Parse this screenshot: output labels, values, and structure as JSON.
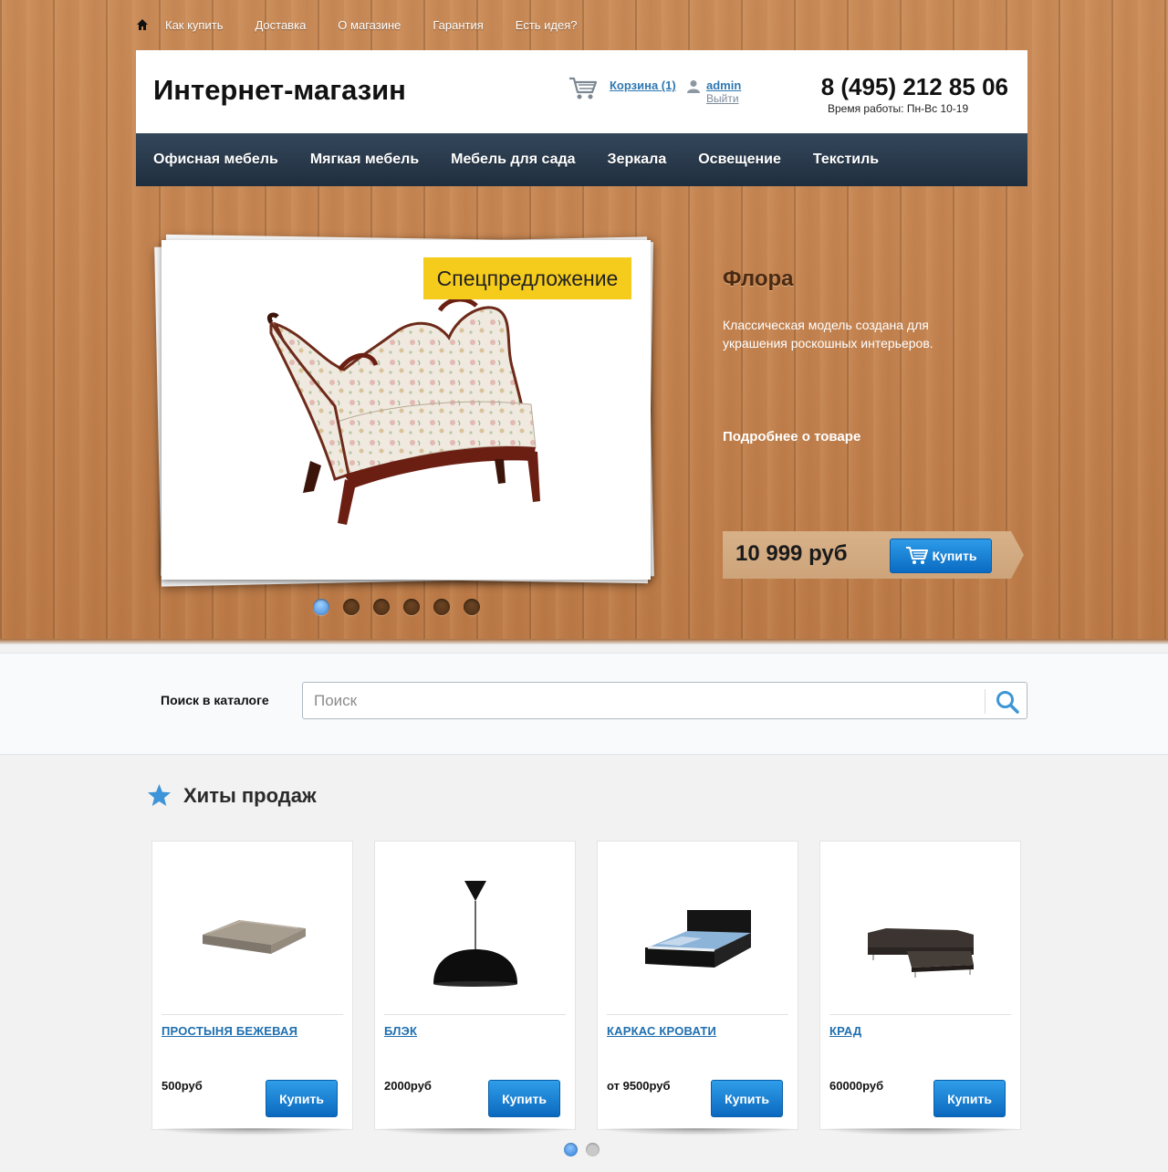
{
  "topnav": {
    "items": [
      "Как купить",
      "Доставка",
      "О магазине",
      "Гарантия",
      "Есть идея?"
    ]
  },
  "header": {
    "logo": "Интернет-магазин",
    "cart_label": "Корзина (1)",
    "user_label": "admin",
    "logout_label": "Выйти",
    "phone": "8 (495) 212 85 06",
    "hours": "Время работы: Пн-Вс 10-19"
  },
  "mainnav": {
    "items": [
      "Офисная мебель",
      "Мягкая мебель",
      "Мебель для сада",
      "Зеркала",
      "Освещение",
      "Текстиль"
    ]
  },
  "slider": {
    "badge": "Спецпредложение",
    "title": "Флора",
    "description": "Классическая модель создана для украшения роскошных интерьеров.",
    "more_link": "Подробнее о товаре",
    "price": "10 999 руб",
    "buy_label": "Купить",
    "slide_count": 6,
    "active_slide": 1
  },
  "search": {
    "label": "Поиск в каталоге",
    "placeholder": "Поиск",
    "value": ""
  },
  "hits": {
    "title": "Хиты продаж",
    "products": [
      {
        "name": "ПРОСТЫНЯ БЕЖЕВАЯ",
        "price": "500руб",
        "buy": "Купить",
        "image": "folded-sheet"
      },
      {
        "name": "БЛЭК",
        "price": "2000руб",
        "buy": "Купить",
        "image": "pendant-lamp"
      },
      {
        "name": "КАРКАС КРОВАТИ",
        "price": "от 9500руб",
        "buy": "Купить",
        "image": "bed-frame"
      },
      {
        "name": "КРАД",
        "price": "60000руб",
        "buy": "Купить",
        "image": "corner-sofa"
      }
    ],
    "page_count": 2,
    "active_page": 1
  },
  "colors": {
    "accent_blue": "#1e6fb0",
    "badge_yellow": "#f5cc1b",
    "nav_dark": "#26384b"
  }
}
